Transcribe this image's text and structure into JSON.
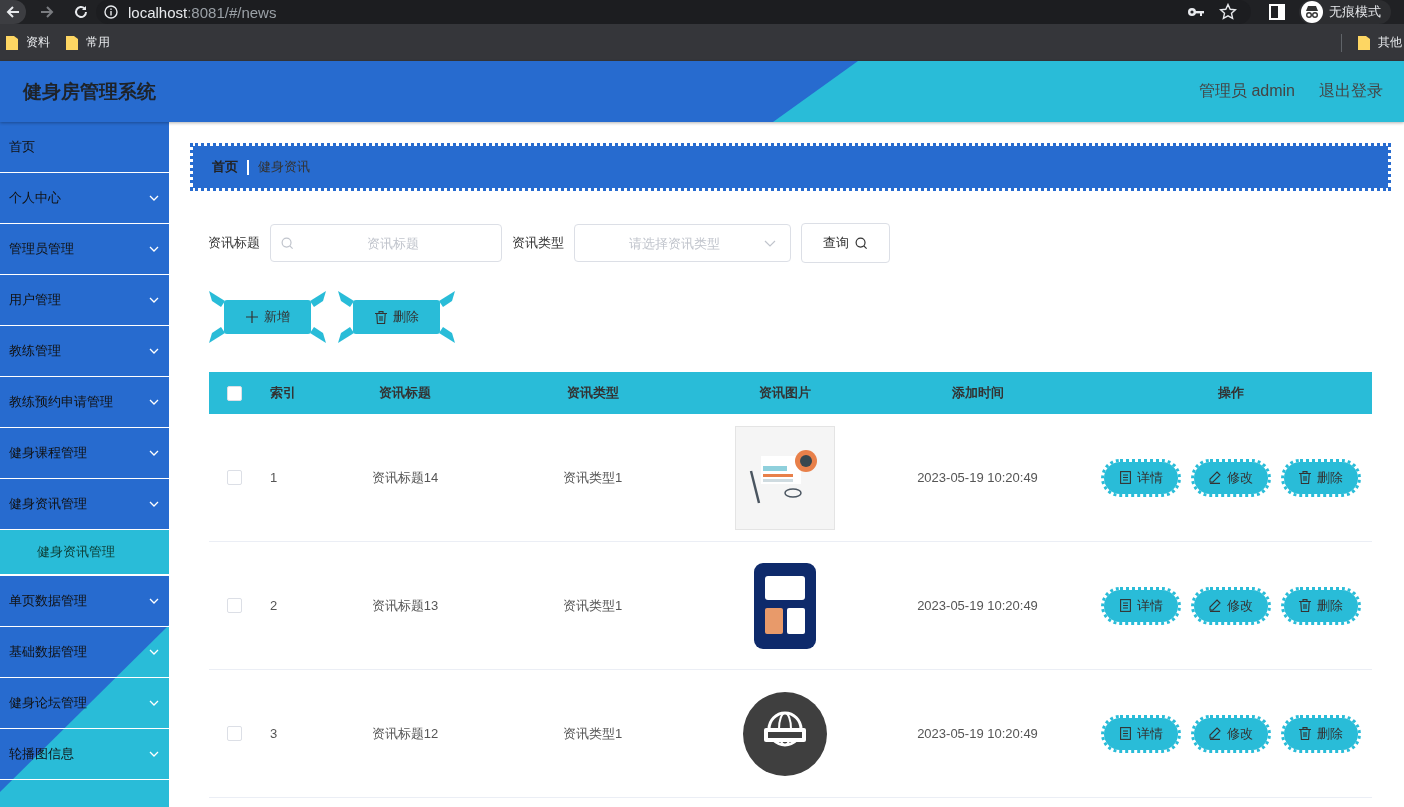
{
  "browser": {
    "url_host": "localhost",
    "url_path": ":8081/#/news",
    "profile_label": "无痕模式",
    "bookmarks": [
      "资料",
      "常用"
    ],
    "other_bookmarks": "其他"
  },
  "header": {
    "title": "健身房管理系统",
    "user": "管理员 admin",
    "logout": "退出登录"
  },
  "sidebar": {
    "items": [
      {
        "kind": "link",
        "label": "首页"
      },
      {
        "kind": "menu",
        "label": "个人中心"
      },
      {
        "kind": "menu",
        "label": "管理员管理"
      },
      {
        "kind": "menu",
        "label": "用户管理"
      },
      {
        "kind": "menu",
        "label": "教练管理"
      },
      {
        "kind": "menu",
        "label": "教练预约申请管理"
      },
      {
        "kind": "menu",
        "label": "健身课程管理"
      },
      {
        "kind": "menu",
        "label": "健身资讯管理",
        "children": [
          {
            "label": "健身资讯管理",
            "selected": true
          }
        ]
      },
      {
        "kind": "menu",
        "label": "单页数据管理"
      },
      {
        "kind": "menu",
        "label": "基础数据管理"
      },
      {
        "kind": "menu",
        "label": "健身论坛管理"
      },
      {
        "kind": "menu",
        "label": "轮播图信息"
      }
    ]
  },
  "breadcrumb": [
    "首页",
    "健身资讯"
  ],
  "search": {
    "fields": [
      {
        "kind": "text",
        "label": "资讯标题",
        "placeholder": "资讯标题"
      },
      {
        "kind": "select",
        "label": "资讯类型",
        "placeholder": "请选择资讯类型"
      }
    ],
    "query_button": "查询"
  },
  "toolbar": [
    {
      "kind": "add",
      "label": "新增"
    },
    {
      "kind": "delete",
      "label": "删除"
    }
  ],
  "table": {
    "header_checked": false,
    "columns": [
      "索引",
      "资讯标题",
      "资讯类型",
      "资讯图片",
      "添加时间",
      "操作"
    ],
    "rows": [
      {
        "checked": false,
        "index": "1",
        "title": "资讯标题14",
        "type": "资讯类型1",
        "time": "2023-05-19 10:20:49",
        "actions": [
          {
            "kind": "detail",
            "label": "详情"
          },
          {
            "kind": "edit",
            "label": "修改"
          },
          {
            "kind": "delete",
            "label": "删除"
          }
        ]
      },
      {
        "checked": false,
        "index": "2",
        "title": "资讯标题13",
        "type": "资讯类型1",
        "time": "2023-05-19 10:20:49",
        "actions": [
          {
            "kind": "detail",
            "label": "详情"
          },
          {
            "kind": "edit",
            "label": "修改"
          },
          {
            "kind": "delete",
            "label": "删除"
          }
        ]
      },
      {
        "checked": false,
        "index": "3",
        "title": "资讯标题12",
        "type": "资讯类型1",
        "time": "2023-05-19 10:20:49",
        "actions": [
          {
            "kind": "detail",
            "label": "详情"
          },
          {
            "kind": "edit",
            "label": "修改"
          },
          {
            "kind": "delete",
            "label": "删除"
          }
        ]
      }
    ]
  }
}
